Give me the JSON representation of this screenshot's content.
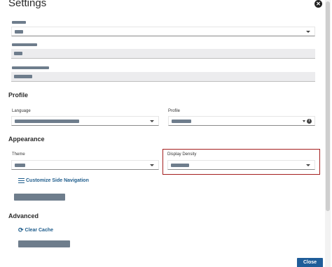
{
  "dialog": {
    "title": "Settings",
    "close_glyph": "✕"
  },
  "sections": {
    "profile": "Profile",
    "appearance": "Appearance",
    "advanced": "Advanced"
  },
  "labels": {
    "language": "Language",
    "profile": "Profile",
    "theme": "Theme",
    "display_density": "Display Density"
  },
  "links": {
    "customize_nav": "Customize Side Navigation",
    "clear_cache": "Clear Cache"
  },
  "buttons": {
    "close": "Close"
  },
  "icons": {
    "dialog_close": "close-circle-icon",
    "info": "info-icon",
    "customize": "hamburger-icon",
    "refresh": "refresh-icon"
  },
  "colors": {
    "accent": "#1f5d99",
    "highlight_border": "#a31d1d",
    "redacted": "#6e7d8c"
  }
}
